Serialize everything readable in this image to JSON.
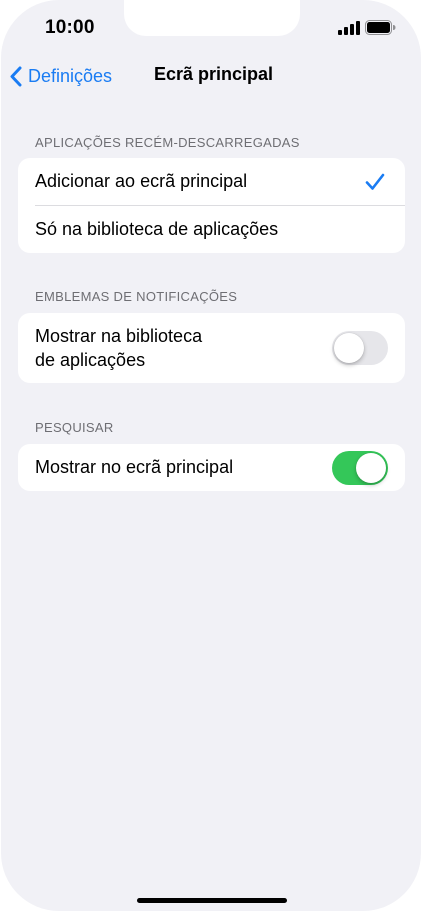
{
  "status_bar": {
    "time": "10:00"
  },
  "navigation": {
    "back_label": "Definições",
    "title": "Ecrã principal"
  },
  "sections": [
    {
      "header": "APLICAÇÕES RECÉM-DESCARREGADAS",
      "rows": [
        {
          "label": "Adicionar ao ecrã principal",
          "selected": true
        },
        {
          "label": "Só na biblioteca de aplicações",
          "selected": false
        }
      ]
    },
    {
      "header": "EMBLEMAS DE NOTIFICAÇÕES",
      "rows": [
        {
          "label_line1": "Mostrar na biblioteca",
          "label_line2": "de aplicações",
          "toggle": "off"
        }
      ]
    },
    {
      "header": "PESQUISAR",
      "rows": [
        {
          "label": "Mostrar no ecrã principal",
          "toggle": "on"
        }
      ]
    }
  ],
  "colors": {
    "accent": "#1a7cf3",
    "toggle_on": "#34c759",
    "toggle_off": "#e6e6ea",
    "background": "#f1f1f6"
  }
}
